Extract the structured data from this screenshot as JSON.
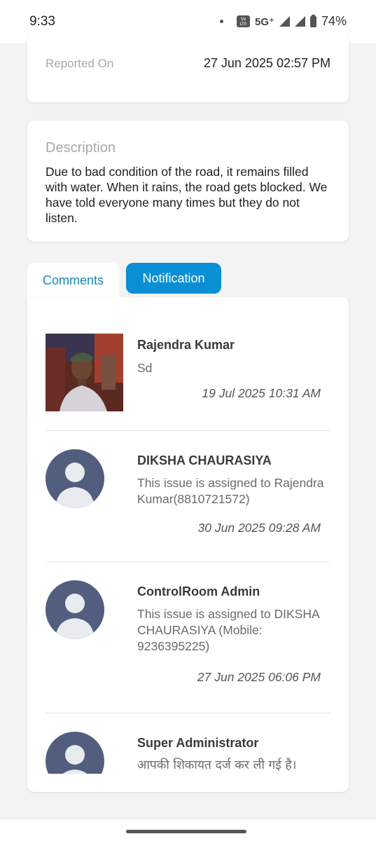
{
  "status_bar": {
    "time": "9:33",
    "volte": "Vo\nLTE",
    "network": "5G⁺",
    "battery": "74%"
  },
  "reported": {
    "label": "Reported On",
    "value": "27 Jun 2025 02:57 PM"
  },
  "description": {
    "title": "Description",
    "text": "Due to bad condition of the road, it remains filled with water. When it rains, the road gets blocked. We have told everyone many times but they do not listen."
  },
  "tabs": {
    "comments": "Comments",
    "notification": "Notification"
  },
  "comments": [
    {
      "name": "Rajendra Kumar",
      "text": "Sd",
      "time": "19 Jul 2025 10:31 AM",
      "avatar": "user-photo"
    },
    {
      "name": "DIKSHA CHAURASIYA",
      "text": "This issue is assigned to Rajendra Kumar(8810721572)",
      "time": "30 Jun 2025 09:28 AM",
      "avatar": "default-user-icon"
    },
    {
      "name": "ControlRoom Admin",
      "text": "This issue is assigned to DIKSHA CHAURASIYA (Mobile: 9236395225)",
      "time": "27 Jun 2025 06:06 PM",
      "avatar": "default-user-icon"
    },
    {
      "name": "Super Administrator",
      "text": "आपकी शिकायत दर्ज कर ली गई है।",
      "time": "",
      "avatar": "default-user-icon"
    }
  ],
  "colors": {
    "accent": "#0b8fd4",
    "avatar_bg": "#525e7e",
    "page_bg": "#f3f3f3"
  }
}
